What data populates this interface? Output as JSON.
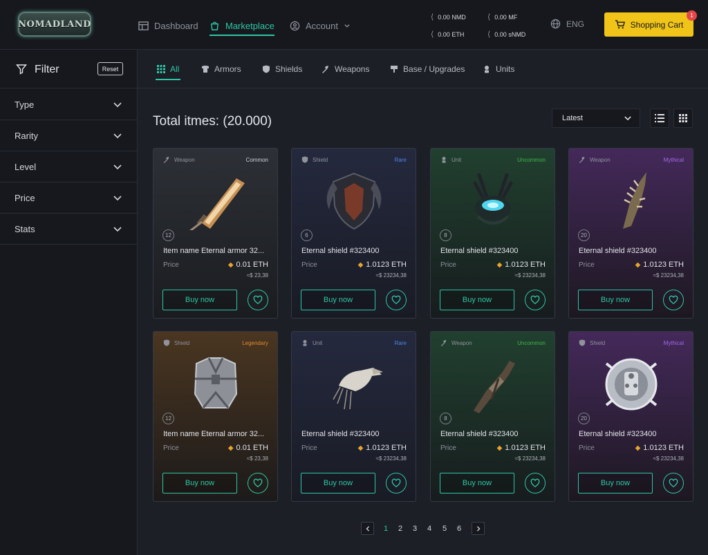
{
  "header": {
    "logo": "NOMADLAND",
    "nav": [
      {
        "label": "Dashboard"
      },
      {
        "label": "Marketplace"
      },
      {
        "label": "Account"
      }
    ],
    "balances": [
      {
        "value": "0.00 NMD"
      },
      {
        "value": "0.00 MF"
      },
      {
        "value": "0.00 ETH"
      },
      {
        "value": "0.00 sNMD"
      }
    ],
    "language": "ENG",
    "cart_label": "Shopping Cart",
    "cart_count": "1",
    "accent": "#2ec7a6",
    "cart_color": "#f0c419"
  },
  "sidebar": {
    "title": "Filter",
    "reset_label": "Reset",
    "filters": [
      {
        "label": "Type"
      },
      {
        "label": "Rarity"
      },
      {
        "label": "Level"
      },
      {
        "label": "Price"
      },
      {
        "label": "Stats"
      }
    ]
  },
  "tabs": [
    {
      "label": "All",
      "icon": "grid-icon"
    },
    {
      "label": "Armors",
      "icon": "armor-icon"
    },
    {
      "label": "Shields",
      "icon": "shield-icon"
    },
    {
      "label": "Weapons",
      "icon": "weapon-icon"
    },
    {
      "label": "Base / Upgrades",
      "icon": "base-icon"
    },
    {
      "label": "Units",
      "icon": "unit-icon"
    }
  ],
  "main": {
    "total_label": "Total itmes: (20.000)",
    "sort_selected": "Latest"
  },
  "cards": [
    {
      "category": "Weapon",
      "rarity": "Common",
      "rarity_color": "#cfd2d8",
      "level": "12",
      "name": "Item name  Eternal armor 32...",
      "price_label": "Price",
      "price": "0.01 ETH",
      "usd": "≈$ 23,38",
      "buy_label": "Buy now",
      "art": "sword"
    },
    {
      "category": "Shield",
      "rarity": "Rare",
      "rarity_color": "#4f84e8",
      "level": "6",
      "name": "Eternal shield #323400",
      "price_label": "Price",
      "price": "1.0123 ETH",
      "usd": "≈$ 23234,38",
      "buy_label": "Buy now",
      "art": "dark-shield"
    },
    {
      "category": "Unit",
      "rarity": "Uncommon",
      "rarity_color": "#3fb54a",
      "level": "8",
      "name": "Eternal shield #323400",
      "price_label": "Price",
      "price": "1.0123 ETH",
      "usd": "≈$ 23234,38",
      "buy_label": "Buy now",
      "art": "crab"
    },
    {
      "category": "Weapon",
      "rarity": "Mythical",
      "rarity_color": "#a868e8",
      "level": "20",
      "name": "Eternal shield #323400",
      "price_label": "Price",
      "price": "1.0123 ETH",
      "usd": "≈$ 23234,38",
      "buy_label": "Buy now",
      "art": "claw"
    },
    {
      "category": "Shield",
      "rarity": "Legendary",
      "rarity_color": "#e08a2e",
      "level": "12",
      "name": "Item name  Eternal armor 32...",
      "price_label": "Price",
      "price": "0.01 ETH",
      "usd": "≈$ 23,38",
      "buy_label": "Buy now",
      "art": "armor"
    },
    {
      "category": "Unit",
      "rarity": "Rare",
      "rarity_color": "#4f84e8",
      "level": "",
      "name": "Eternal shield #323400",
      "price_label": "Price",
      "price": "1.0123 ETH",
      "usd": "≈$ 23234,38",
      "buy_label": "Buy now",
      "art": "bird"
    },
    {
      "category": "Weapon",
      "rarity": "Uncommon",
      "rarity_color": "#3fb54a",
      "level": "8",
      "name": "Eternal shield #323400",
      "price_label": "Price",
      "price": "1.0123 ETH",
      "usd": "≈$ 23234,38",
      "buy_label": "Buy now",
      "art": "gun"
    },
    {
      "category": "Shield",
      "rarity": "Mythical",
      "rarity_color": "#a868e8",
      "level": "20",
      "name": "Eternal shield #323400",
      "price_label": "Price",
      "price": "1.0123 ETH",
      "usd": "≈$ 23234,38",
      "buy_label": "Buy now",
      "art": "round-shield"
    }
  ],
  "pagination": {
    "pages": [
      "1",
      "2",
      "3",
      "4",
      "5",
      "6"
    ],
    "current": "1"
  }
}
